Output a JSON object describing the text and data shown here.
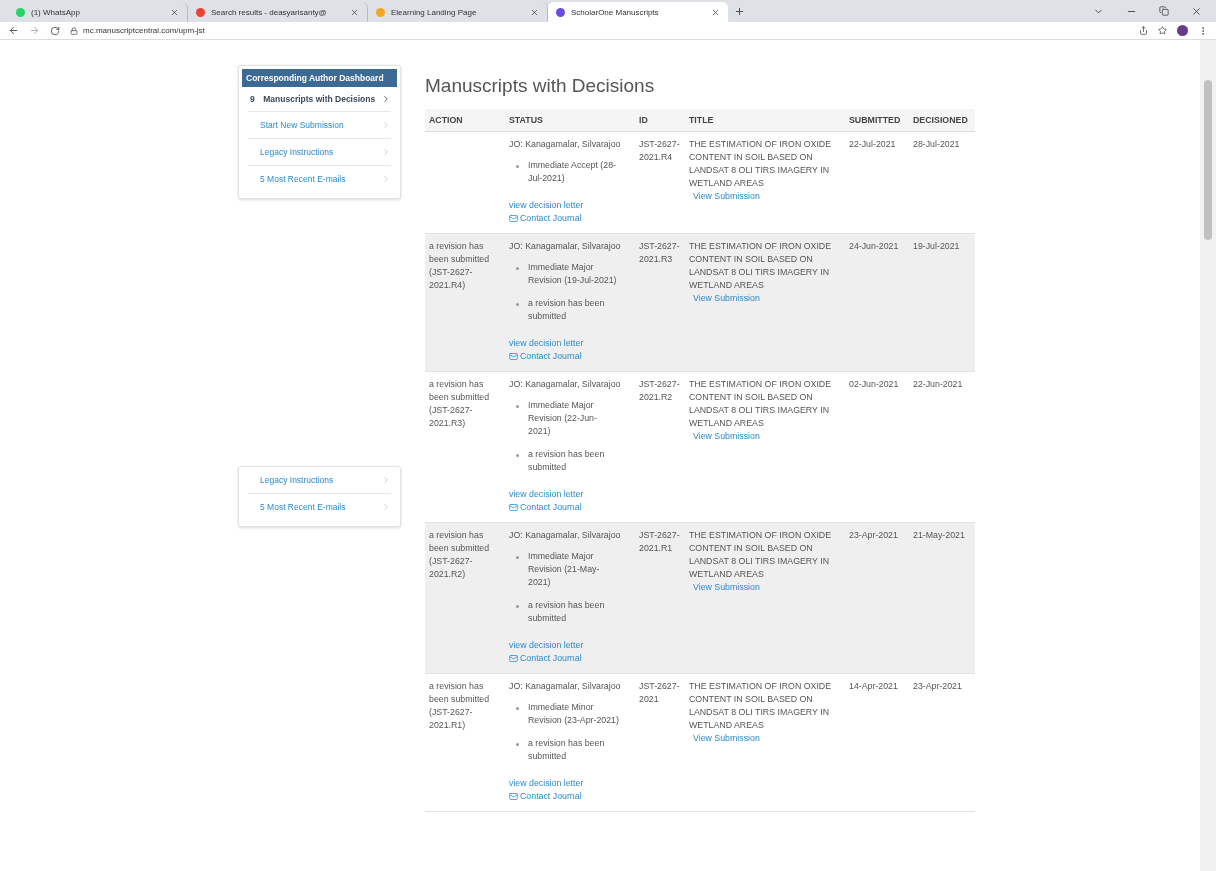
{
  "browser": {
    "tabs": [
      {
        "title": "(1) WhatsApp",
        "selected": false
      },
      {
        "title": "Search results - deasyarisanty@",
        "selected": false
      },
      {
        "title": "Elearning Landing Page",
        "selected": false
      },
      {
        "title": "ScholarOne Manuscripts",
        "selected": true
      }
    ],
    "url": "mc.manuscriptcentral.com/upm-jst"
  },
  "sidebar": {
    "title": "Corresponding Author Dashboard",
    "items": [
      {
        "count": "9",
        "label": "Manuscripts with Decisions",
        "selected": true
      },
      {
        "label": "Start New Submission",
        "selected": false
      },
      {
        "label": "Legacy Instructions",
        "selected": false
      },
      {
        "label": "5 Most Recent E-mails",
        "selected": false
      }
    ]
  },
  "sidebar_fragment": {
    "items": [
      {
        "label": "Legacy Instructions",
        "selected": false
      },
      {
        "label": "5 Most Recent E-mails",
        "selected": false
      }
    ]
  },
  "page_title": "Manuscripts with Decisions",
  "table": {
    "columns": [
      "ACTION",
      "STATUS",
      "ID",
      "TITLE",
      "SUBMITTED",
      "DECISIONED"
    ],
    "rows": [
      {
        "shaded": false,
        "action": "",
        "author": "JO: Kanagamalar, Silvarajoo",
        "events": [
          "Immediate Accept (28-Jul-2021)"
        ],
        "decision_link": "view decision letter",
        "contact_link": "Contact Journal",
        "id": "JST-2627-2021.R4",
        "title": "THE ESTIMATION OF IRON OXIDE CONTENT IN SOIL BASED ON LANDSAT 8 OLI TIRS IMAGERY IN WETLAND AREAS",
        "view_link": "View Submission",
        "submitted": "22-Jul-2021",
        "decisioned": "28-Jul-2021"
      },
      {
        "shaded": true,
        "action": "a revision has been submitted (JST-2627-2021.R4)",
        "author": "JO: Kanagamalar, Silvarajoo",
        "events": [
          "Immediate Major Revision (19-Jul-2021)",
          "a revision has been submitted"
        ],
        "decision_link": "view decision letter",
        "contact_link": "Contact Journal",
        "id": "JST-2627-2021.R3",
        "title": "THE ESTIMATION OF IRON OXIDE CONTENT IN SOIL BASED ON LANDSAT 8 OLI TIRS IMAGERY IN WETLAND AREAS",
        "view_link": "View Submission",
        "submitted": "24-Jun-2021",
        "decisioned": "19-Jul-2021"
      },
      {
        "shaded": false,
        "action": "a revision has been submitted (JST-2627-2021.R3)",
        "author": "JO: Kanagamalar, Silvarajoo",
        "events": [
          "Immediate Major Revision (22-Jun-2021)",
          "a revision has been submitted"
        ],
        "decision_link": "view decision letter",
        "contact_link": "Contact Journal",
        "id": "JST-2627-2021.R2",
        "title": "THE ESTIMATION OF IRON OXIDE CONTENT IN SOIL BASED ON LANDSAT 8 OLI TIRS IMAGERY IN WETLAND AREAS",
        "view_link": "View Submission",
        "submitted": "02-Jun-2021",
        "decisioned": "22-Jun-2021"
      },
      {
        "shaded": true,
        "action": "a revision has been submitted (JST-2627-2021.R2)",
        "author": "JO: Kanagamalar, Silvarajoo",
        "events": [
          "Immediate Major Revision (21-May-2021)",
          "a revision has been submitted"
        ],
        "decision_link": "view decision letter",
        "contact_link": "Contact Journal",
        "id": "JST-2627-2021.R1",
        "title": "THE ESTIMATION OF IRON OXIDE CONTENT IN SOIL BASED ON LANDSAT 8 OLI TIRS IMAGERY IN WETLAND AREAS",
        "view_link": "View Submission",
        "submitted": "23-Apr-2021",
        "decisioned": "21-May-2021"
      },
      {
        "shaded": false,
        "action": "a revision has been submitted (JST-2627-2021.R1)",
        "author": "JO: Kanagamalar, Silvarajoo",
        "events": [
          "Immediate Minor Revision (23-Apr-2021)",
          "a revision has been submitted"
        ],
        "decision_link": "view decision letter",
        "contact_link": "Contact Journal",
        "id": "JST-2627-2021",
        "title": "THE ESTIMATION OF IRON OXIDE CONTENT IN SOIL BASED ON LANDSAT 8 OLI TIRS IMAGERY IN WETLAND AREAS",
        "view_link": "View Submission",
        "submitted": "14-Apr-2021",
        "decisioned": "23-Apr-2021"
      }
    ]
  }
}
